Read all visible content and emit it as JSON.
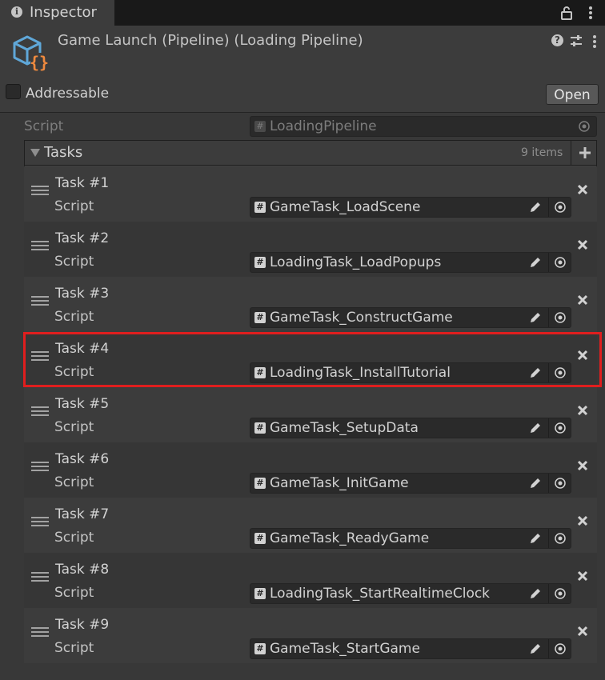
{
  "tab": {
    "label": "Inspector"
  },
  "header": {
    "title": "Game Launch (Pipeline) (Loading Pipeline)",
    "open_label": "Open",
    "addressable_label": "Addressable",
    "addressable_checked": false
  },
  "script": {
    "label": "Script",
    "value": "LoadingPipeline"
  },
  "tasks": {
    "label": "Tasks",
    "count": "9 items",
    "items": [
      {
        "title": "Task #1",
        "script_label": "Script",
        "value": "GameTask_LoadScene"
      },
      {
        "title": "Task #2",
        "script_label": "Script",
        "value": "LoadingTask_LoadPopups"
      },
      {
        "title": "Task #3",
        "script_label": "Script",
        "value": "GameTask_ConstructGame"
      },
      {
        "title": "Task #4",
        "script_label": "Script",
        "value": "LoadingTask_InstallTutorial"
      },
      {
        "title": "Task #5",
        "script_label": "Script",
        "value": "GameTask_SetupData"
      },
      {
        "title": "Task #6",
        "script_label": "Script",
        "value": "GameTask_InitGame"
      },
      {
        "title": "Task #7",
        "script_label": "Script",
        "value": "GameTask_ReadyGame"
      },
      {
        "title": "Task #8",
        "script_label": "Script",
        "value": "LoadingTask_StartRealtimeClock"
      },
      {
        "title": "Task #9",
        "script_label": "Script",
        "value": "GameTask_StartGame"
      }
    ]
  },
  "colors": {
    "highlight": "#e01e1e",
    "asset_icon_blue": "#5fa7d8",
    "asset_icon_orange": "#f08a3e"
  },
  "icons": {
    "tab": "info-icon",
    "header": [
      "lock-icon",
      "help-icon",
      "preset-icon",
      "kebab-icon"
    ],
    "row": [
      "drag-handle-icon",
      "hash-icon",
      "edit-icon",
      "target-icon",
      "remove-icon"
    ]
  }
}
